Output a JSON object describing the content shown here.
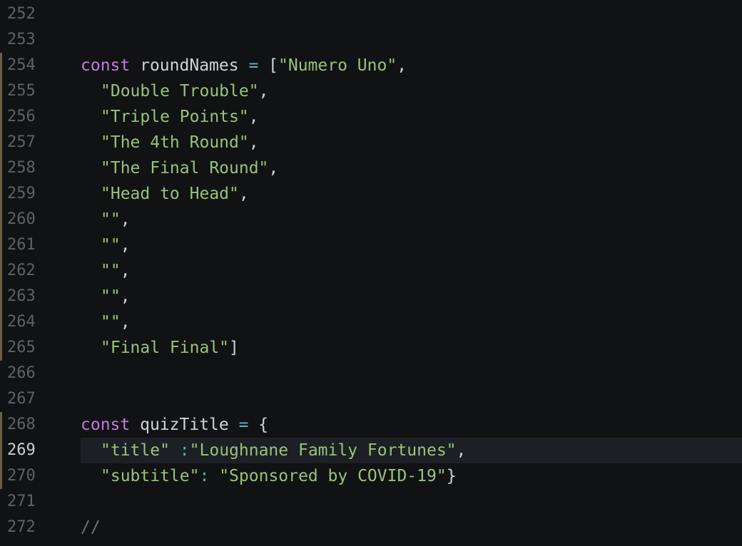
{
  "editor": {
    "colors": {
      "background": "#111214",
      "keyword": "#c678dd",
      "string": "#98c379",
      "operator": "#56b6c2",
      "identifier": "#cfd3d8",
      "line_number": "#5d6168",
      "current_line_number": "#c9ccd1",
      "modified_marker": "#6b5f45"
    },
    "lines": [
      {
        "number": "252",
        "modified": false,
        "active": false,
        "indent": 0,
        "tokens": []
      },
      {
        "number": "253",
        "modified": false,
        "active": false,
        "indent": 0,
        "tokens": []
      },
      {
        "number": "254",
        "modified": true,
        "active": false,
        "indent": 0,
        "tokens": [
          {
            "type": "kw",
            "text": "const"
          },
          {
            "type": "pn",
            "text": " "
          },
          {
            "type": "id",
            "text": "roundNames"
          },
          {
            "type": "pn",
            "text": " "
          },
          {
            "type": "op",
            "text": "="
          },
          {
            "type": "pn",
            "text": " ["
          },
          {
            "type": "str",
            "text": "\"Numero Uno\""
          },
          {
            "type": "pn",
            "text": ","
          }
        ]
      },
      {
        "number": "255",
        "modified": true,
        "active": false,
        "indent": 1,
        "tokens": [
          {
            "type": "str",
            "text": "\"Double Trouble\""
          },
          {
            "type": "pn",
            "text": ","
          }
        ]
      },
      {
        "number": "256",
        "modified": true,
        "active": false,
        "indent": 1,
        "tokens": [
          {
            "type": "str",
            "text": "\"Triple Points\""
          },
          {
            "type": "pn",
            "text": ","
          }
        ]
      },
      {
        "number": "257",
        "modified": true,
        "active": false,
        "indent": 1,
        "tokens": [
          {
            "type": "str",
            "text": "\"The 4th Round\""
          },
          {
            "type": "pn",
            "text": ","
          }
        ]
      },
      {
        "number": "258",
        "modified": true,
        "active": false,
        "indent": 1,
        "tokens": [
          {
            "type": "str",
            "text": "\"The Final Round\""
          },
          {
            "type": "pn",
            "text": ","
          }
        ]
      },
      {
        "number": "259",
        "modified": true,
        "active": false,
        "indent": 1,
        "tokens": [
          {
            "type": "str",
            "text": "\"Head to Head\""
          },
          {
            "type": "pn",
            "text": ","
          }
        ]
      },
      {
        "number": "260",
        "modified": true,
        "active": false,
        "indent": 1,
        "tokens": [
          {
            "type": "str",
            "text": "\"\""
          },
          {
            "type": "pn",
            "text": ","
          }
        ]
      },
      {
        "number": "261",
        "modified": true,
        "active": false,
        "indent": 1,
        "tokens": [
          {
            "type": "str",
            "text": "\"\""
          },
          {
            "type": "pn",
            "text": ","
          }
        ]
      },
      {
        "number": "262",
        "modified": true,
        "active": false,
        "indent": 1,
        "tokens": [
          {
            "type": "str",
            "text": "\"\""
          },
          {
            "type": "pn",
            "text": ","
          }
        ]
      },
      {
        "number": "263",
        "modified": true,
        "active": false,
        "indent": 1,
        "tokens": [
          {
            "type": "str",
            "text": "\"\""
          },
          {
            "type": "pn",
            "text": ","
          }
        ]
      },
      {
        "number": "264",
        "modified": true,
        "active": false,
        "indent": 1,
        "tokens": [
          {
            "type": "str",
            "text": "\"\""
          },
          {
            "type": "pn",
            "text": ","
          }
        ]
      },
      {
        "number": "265",
        "modified": true,
        "active": false,
        "indent": 1,
        "tokens": [
          {
            "type": "str",
            "text": "\"Final Final\""
          },
          {
            "type": "pn",
            "text": "]"
          }
        ]
      },
      {
        "number": "266",
        "modified": false,
        "active": false,
        "indent": 0,
        "tokens": []
      },
      {
        "number": "267",
        "modified": false,
        "active": false,
        "indent": 0,
        "tokens": []
      },
      {
        "number": "268",
        "modified": true,
        "active": false,
        "indent": 0,
        "tokens": [
          {
            "type": "kw",
            "text": "const"
          },
          {
            "type": "pn",
            "text": " "
          },
          {
            "type": "id",
            "text": "quizTitle"
          },
          {
            "type": "pn",
            "text": " "
          },
          {
            "type": "op",
            "text": "="
          },
          {
            "type": "pn",
            "text": " {"
          }
        ]
      },
      {
        "number": "269",
        "modified": true,
        "active": true,
        "indent": 1,
        "tokens": [
          {
            "type": "str",
            "text": "\"title\""
          },
          {
            "type": "pn",
            "text": " "
          },
          {
            "type": "op",
            "text": ":"
          },
          {
            "type": "str",
            "text": "\"Loughnane Family Fortunes\""
          },
          {
            "type": "pn",
            "text": ","
          }
        ]
      },
      {
        "number": "270",
        "modified": true,
        "active": false,
        "indent": 1,
        "tokens": [
          {
            "type": "str",
            "text": "\"subtitle\""
          },
          {
            "type": "op",
            "text": ":"
          },
          {
            "type": "pn",
            "text": " "
          },
          {
            "type": "str",
            "text": "\"Sponsored by COVID-19\""
          },
          {
            "type": "pn",
            "text": "}"
          }
        ]
      },
      {
        "number": "271",
        "modified": false,
        "active": false,
        "indent": 0,
        "tokens": []
      },
      {
        "number": "272",
        "modified": false,
        "active": false,
        "indent": 0,
        "tokens": [
          {
            "type": "cm",
            "text": "//"
          }
        ]
      }
    ]
  }
}
